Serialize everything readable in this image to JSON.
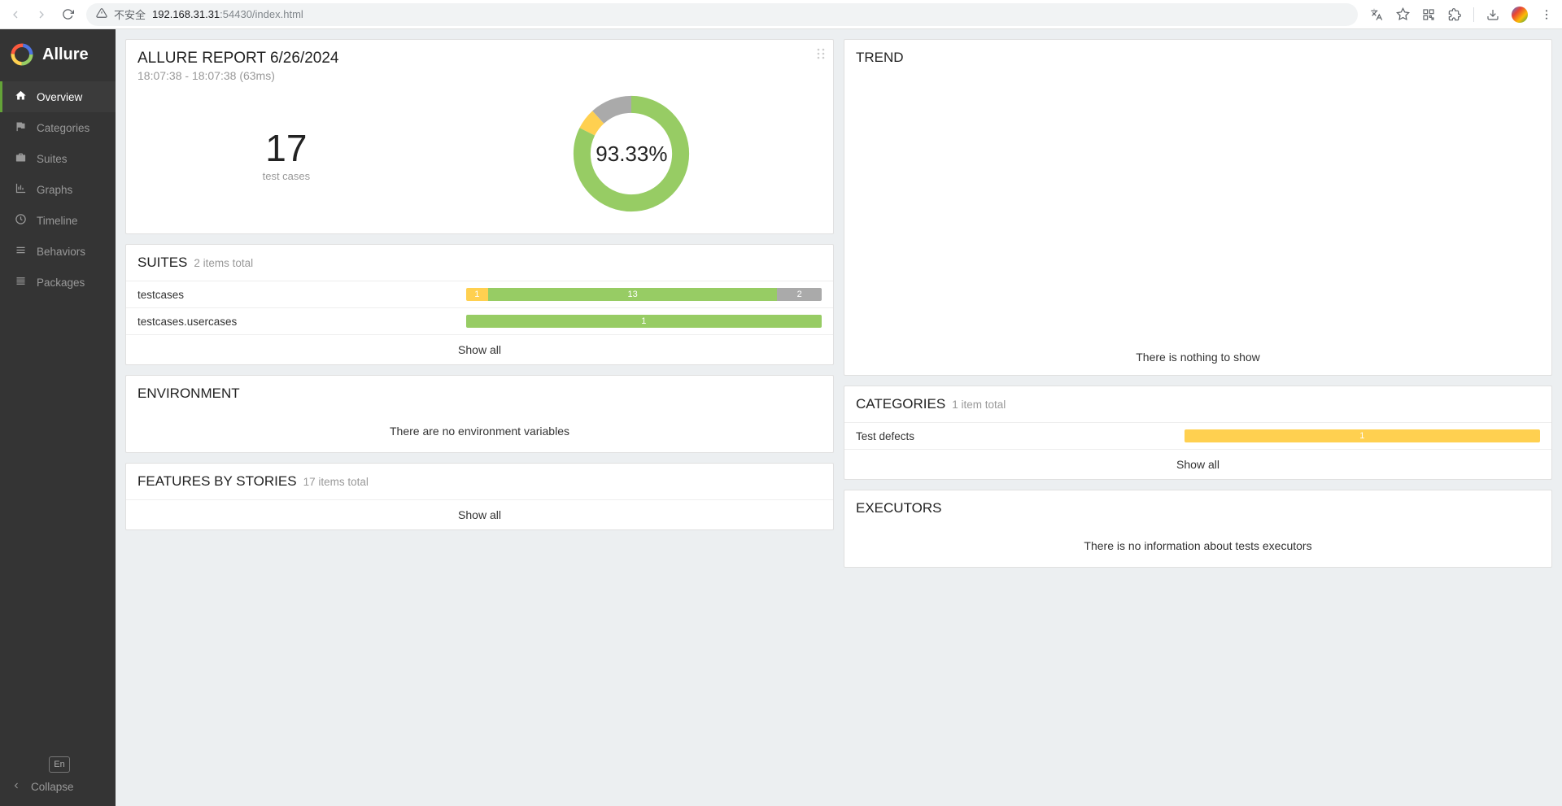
{
  "browser": {
    "insecure_label": "不安全",
    "url_host": "192.168.31.31",
    "url_port": ":54430",
    "url_path": "/index.html"
  },
  "sidebar": {
    "brand": "Allure",
    "items": [
      {
        "label": "Overview"
      },
      {
        "label": "Categories"
      },
      {
        "label": "Suites"
      },
      {
        "label": "Graphs"
      },
      {
        "label": "Timeline"
      },
      {
        "label": "Behaviors"
      },
      {
        "label": "Packages"
      }
    ],
    "lang": "En",
    "collapse": "Collapse"
  },
  "summary": {
    "title": "ALLURE REPORT 6/26/2024",
    "datetime": "18:07:38 - 18:07:38 (63ms)",
    "count": "17",
    "count_label": "test cases",
    "rate": "93.33%"
  },
  "suites": {
    "title": "SUITES",
    "subtitle": "2 items total",
    "rows": [
      {
        "label": "testcases",
        "broken": "1",
        "passed": "13",
        "skipped": "2"
      },
      {
        "label": "testcases.usercases",
        "broken": null,
        "passed": "1",
        "skipped": null
      }
    ],
    "show_all": "Show all"
  },
  "env": {
    "title": "ENVIRONMENT",
    "empty": "There are no environment variables"
  },
  "features": {
    "title": "FEATURES BY STORIES",
    "subtitle": "17 items total",
    "show_all": "Show all"
  },
  "trend": {
    "title": "TREND",
    "empty": "There is nothing to show"
  },
  "categories": {
    "title": "CATEGORIES",
    "subtitle": "1 item total",
    "row_label": "Test defects",
    "row_value": "1",
    "show_all": "Show all"
  },
  "executors": {
    "title": "EXECUTORS",
    "empty": "There is no information about tests executors"
  },
  "chart_data": {
    "type": "pie",
    "title": "Test results",
    "center_label": "93.33%",
    "total": 17,
    "series": [
      {
        "name": "passed",
        "value": 14,
        "color": "#97cc64"
      },
      {
        "name": "broken",
        "value": 1,
        "color": "#ffd050"
      },
      {
        "name": "skipped",
        "value": 2,
        "color": "#aaaaaa"
      }
    ]
  }
}
